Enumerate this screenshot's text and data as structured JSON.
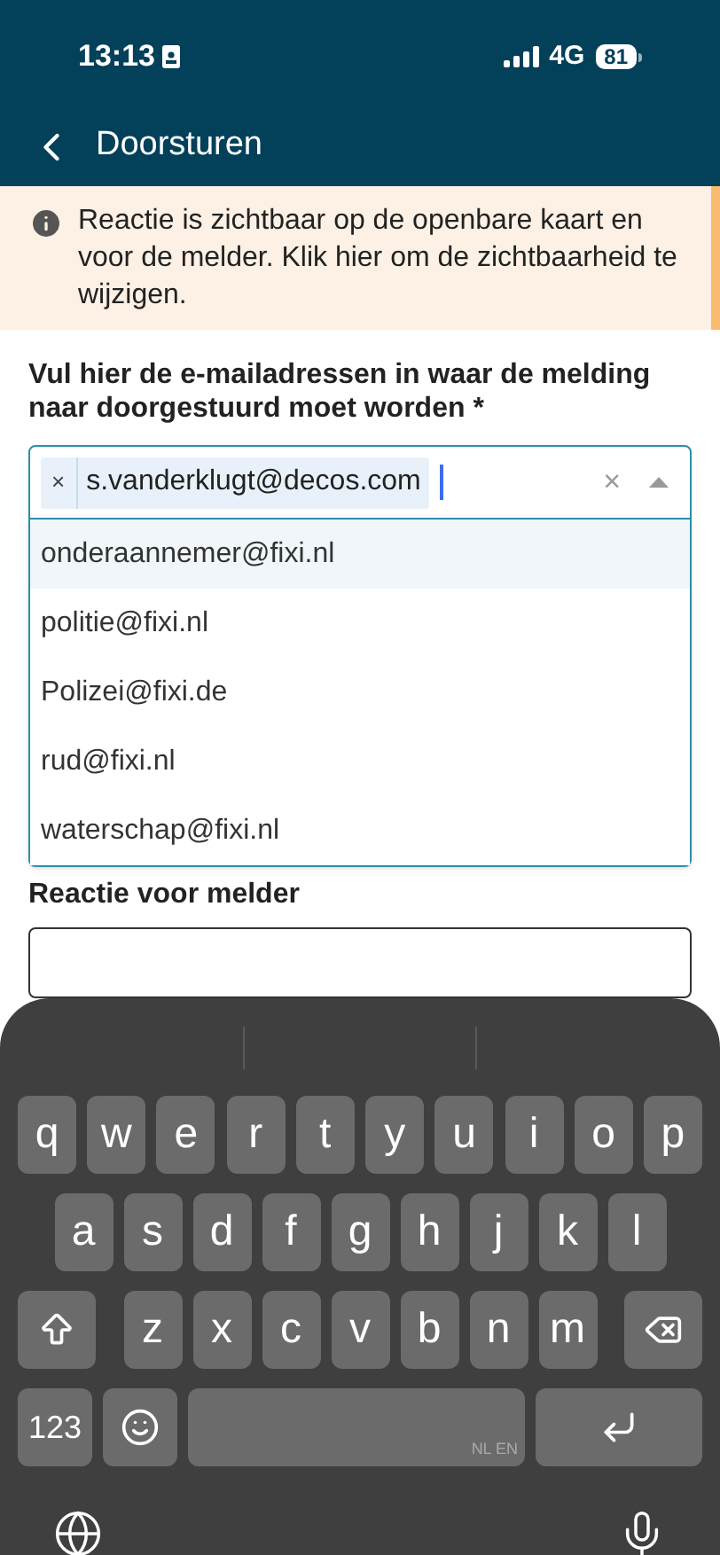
{
  "status_bar": {
    "time": "13:13",
    "network": "4G",
    "battery": "81"
  },
  "header": {
    "title": "Doorsturen"
  },
  "notice": {
    "text": "Reactie is zichtbaar op de openbare kaart en voor de melder. Klik hier om de zichtbaarheid te wijzigen."
  },
  "recipients": {
    "label": "Vul hier de e-mailadressen in waar de melding naar doorgestuurd moet worden *",
    "tags": [
      {
        "label": "s.vanderklugt@decos.com",
        "remove": "×"
      }
    ],
    "clear": "×",
    "expanded": true,
    "options": [
      {
        "label": "onderaannemer@fixi.nl",
        "selected": true
      },
      {
        "label": "politie@fixi.nl",
        "selected": false
      },
      {
        "label": "Polizei@fixi.de",
        "selected": false
      },
      {
        "label": "rud@fixi.nl",
        "selected": false
      },
      {
        "label": "waterschap@fixi.nl",
        "selected": false
      }
    ]
  },
  "comment": {
    "label": "Reactie voor melder"
  },
  "keyboard": {
    "rows": [
      [
        "q",
        "w",
        "e",
        "r",
        "t",
        "y",
        "u",
        "i",
        "o",
        "p"
      ],
      [
        "a",
        "s",
        "d",
        "f",
        "g",
        "h",
        "j",
        "k",
        "l"
      ],
      [
        "z",
        "x",
        "c",
        "v",
        "b",
        "n",
        "m"
      ]
    ],
    "number_key": "123",
    "space_label": "NL EN"
  }
}
